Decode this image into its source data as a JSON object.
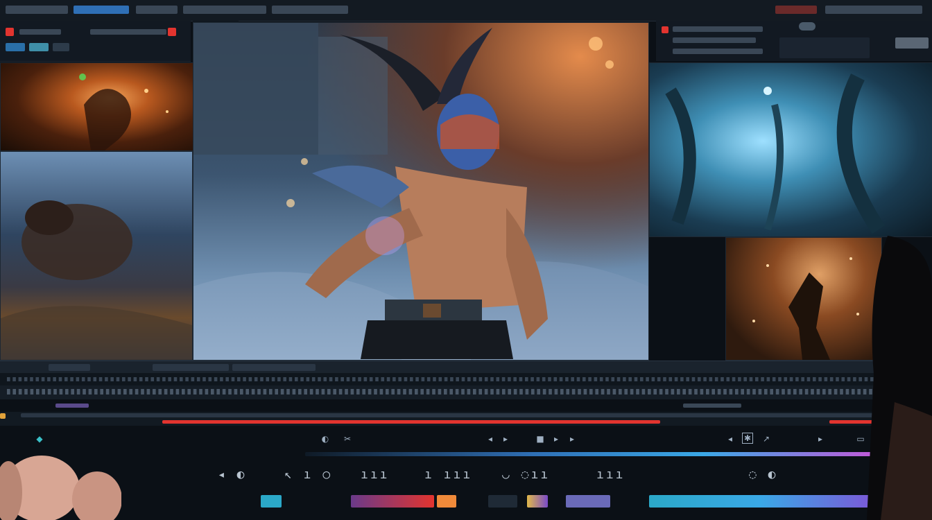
{
  "colors": {
    "accent_red": "#e2342f",
    "accent_blue": "#3aa8e6",
    "accent_magenta": "#c05ad8",
    "accent_orange": "#f08a3a",
    "panel_bg": "#121922"
  },
  "icons": {
    "timeline_left": "diamond-icon",
    "transport_right": "settings-icon"
  },
  "timeline": {
    "playhead_progress_left": 0.74,
    "playhead_progress_right": 0.05
  }
}
